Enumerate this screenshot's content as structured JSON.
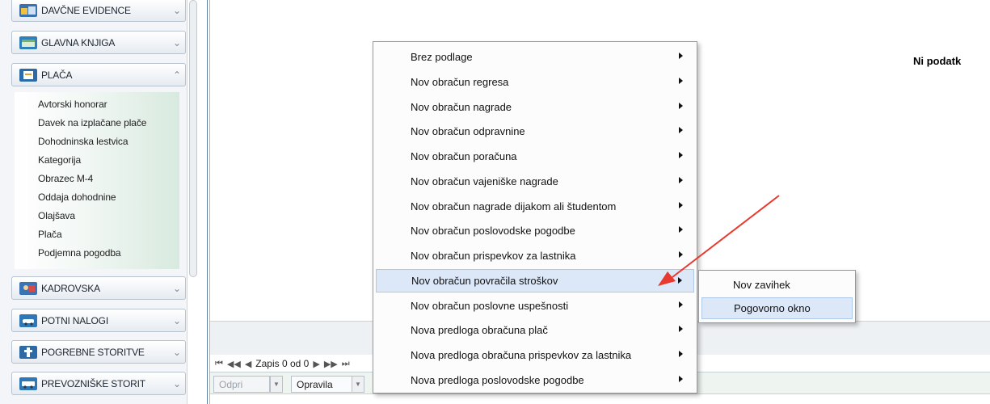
{
  "nav": {
    "sections": [
      {
        "label": "DAVČNE EVIDENCE",
        "icon": "tax-records-icon",
        "expanded": false
      },
      {
        "label": "GLAVNA KNJIGA",
        "icon": "general-ledger-icon",
        "expanded": false
      },
      {
        "label": "PLAČA",
        "icon": "payroll-icon",
        "expanded": true
      },
      {
        "label": "KADROVSKA",
        "icon": "personnel-icon",
        "expanded": false
      },
      {
        "label": "POTNI NALOGI",
        "icon": "travel-orders-icon",
        "expanded": false
      },
      {
        "label": "POGREBNE STORITVE",
        "icon": "funeral-services-icon",
        "expanded": false
      },
      {
        "label": "PREVOZNIŠKE STORIT",
        "icon": "transport-services-icon",
        "expanded": false
      }
    ],
    "placa_items": [
      "Avtorski honorar",
      "Davek na izplačane plače",
      "Dohodninska lestvica",
      "Kategorija",
      "Obrazec M-4",
      "Oddaja dohodnine",
      "Olajšava",
      "Plača",
      "Podjemna pogodba"
    ]
  },
  "main": {
    "no_data_text": "Ni podatk"
  },
  "pager": {
    "first": "⏮",
    "prev_page": "◀◀",
    "prev": "◀",
    "record_text": "Zapis 0 od 0",
    "next": "▶",
    "next_page": "▶▶",
    "last": "⏭"
  },
  "toolbar": {
    "open_label": "Odpri",
    "tasks_label": "Opravila"
  },
  "context_menu": {
    "items": [
      "Brez podlage",
      "Nov obračun regresa",
      "Nov obračun nagrade",
      "Nov obračun odpravnine",
      "Nov obračun poračuna",
      "Nov obračun vajeniške nagrade",
      "Nov obračun nagrade dijakom ali študentom",
      "Nov obračun poslovodske pogodbe",
      "Nov obračun prispevkov za lastnika",
      "Nov obračun povračila stroškov",
      "Nov obračun poslovne uspešnosti",
      "Nova predloga obračuna plač",
      "Nova predloga obračuna prispevkov za lastnika",
      "Nova predloga poslovodske pogodbe"
    ],
    "highlighted_index": 9
  },
  "submenu": {
    "items": [
      "Nov zavihek",
      "Pogovorno okno"
    ],
    "highlighted_index": 1
  },
  "colors": {
    "highlight": "#dce8f8",
    "arrow": "#e8392f"
  }
}
